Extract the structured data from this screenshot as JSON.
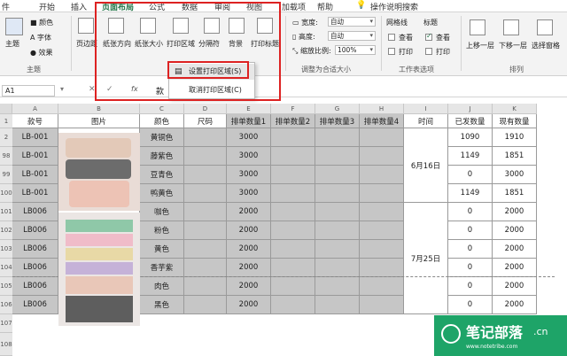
{
  "tabs": [
    {
      "label": "件"
    },
    {
      "label": "开始"
    },
    {
      "label": "插入"
    },
    {
      "label": "页面布局"
    },
    {
      "label": "公式"
    },
    {
      "label": "数据"
    },
    {
      "label": "审阅"
    },
    {
      "label": "视图"
    },
    {
      "label": "加载项"
    },
    {
      "label": "帮助"
    },
    {
      "label": "操作说明搜索"
    }
  ],
  "ribbon": {
    "theme": {
      "themes": "主题",
      "colors": "颜色",
      "fonts": "字体",
      "effects": "效果",
      "group": "主题"
    },
    "page_setup": {
      "margins": "页边距",
      "orientation": "纸张方向",
      "size": "纸张大小",
      "print_area": "打印区域",
      "breaks": "分隔符",
      "background": "背景",
      "print_titles": "打印标题"
    },
    "scale": {
      "width_label": "宽度:",
      "width_value": "自动",
      "height_label": "高度:",
      "height_value": "自动",
      "scale_label": "缩放比例:",
      "scale_value": "100%",
      "group": "调整为合适大小"
    },
    "sheet_options": {
      "gridlines": "网格线",
      "headings": "标题",
      "view": "查看",
      "print": "打印",
      "group": "工作表选项"
    },
    "arrange": {
      "bring_forward": "上移一层",
      "send_backward": "下移一层",
      "selection_pane": "选择窗格",
      "group": "排列"
    }
  },
  "menu": {
    "set_print_area": "设置打印区域(S)",
    "clear_print_area": "取消打印区域(C)"
  },
  "formula_bar": {
    "name_box": "A1",
    "fx": "fx",
    "value": "款"
  },
  "columns": [
    "A",
    "B",
    "C",
    "D",
    "E",
    "F",
    "G",
    "H",
    "I",
    "J",
    "K"
  ],
  "rows": [
    "1",
    "2",
    "98",
    "99",
    "100",
    "101",
    "102",
    "103",
    "104",
    "105",
    "106",
    "107",
    "108"
  ],
  "header": [
    "款号",
    "图片",
    "颜色",
    "尺码",
    "排单数量1",
    "排单数量2",
    "排单数量3",
    "排单数量4",
    "时间",
    "已发数量",
    "现有数量"
  ],
  "data_rows": [
    [
      "LB-001",
      "",
      "黄铜色",
      "",
      "3000",
      "",
      "",
      "",
      "",
      "1090",
      "1910"
    ],
    [
      "LB-001",
      "",
      "藤紫色",
      "",
      "3000",
      "",
      "",
      "",
      "",
      "1149",
      "1851"
    ],
    [
      "LB-001",
      "",
      "豆青色",
      "",
      "3000",
      "",
      "",
      "",
      "",
      "0",
      "3000"
    ],
    [
      "LB-001",
      "",
      "鸭黄色",
      "",
      "3000",
      "",
      "",
      "",
      "",
      "1149",
      "1851"
    ],
    [
      "LB006",
      "",
      "咖色",
      "",
      "2000",
      "",
      "",
      "",
      "",
      "0",
      "2000"
    ],
    [
      "LB006",
      "",
      "粉色",
      "",
      "2000",
      "",
      "",
      "",
      "",
      "0",
      "2000"
    ],
    [
      "LB006",
      "",
      "黄色",
      "",
      "2000",
      "",
      "",
      "",
      "",
      "0",
      "2000"
    ],
    [
      "LB006",
      "",
      "香芋紫",
      "",
      "2000",
      "",
      "",
      "",
      "",
      "0",
      "2000"
    ],
    [
      "LB006",
      "",
      "肉色",
      "",
      "2000",
      "",
      "",
      "",
      "",
      "0",
      "2000"
    ],
    [
      "LB006",
      "",
      "黑色",
      "",
      "2000",
      "",
      "",
      "",
      "",
      "0",
      "2000"
    ]
  ],
  "dates": [
    "6月16日",
    "7月25日"
  ],
  "watermark": {
    "name": "笔记部落",
    "suffix": ".cn",
    "url": "www.notetribe.com"
  }
}
